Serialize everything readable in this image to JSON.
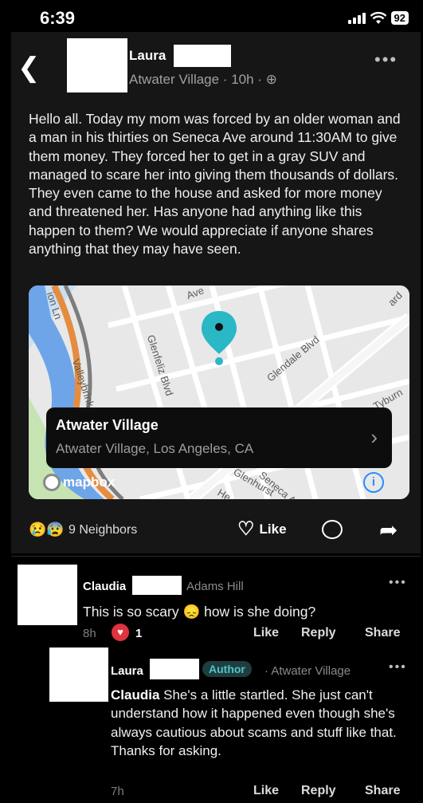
{
  "status": {
    "time": "6:39",
    "battery": "92"
  },
  "post": {
    "author_name": "Laura",
    "meta": "Atwater Village · 10h · ",
    "body": "Hello all. Today my mom was forced by an older woman and a man in his thirties on Seneca Ave around 11:30AM to give them money. They forced her to get in a gray SUV and managed to scare her into giving them thousands of dollars. They even came to the house and asked for more money and threatened her. Has anyone had anything like this happen to them? We would appreciate if anyone shares anything that they may have seen.",
    "location": {
      "title": "Atwater Village",
      "subtitle": "Atwater Village, Los Angeles, CA"
    },
    "map_labels": [
      "Valleybrink Rd",
      "Glenfeliz Blvd",
      "Glendale Blvd",
      "Seneca Ave",
      "Glenhurst",
      "ion Ln",
      "Tyburn",
      "Ave",
      "ard",
      "He"
    ],
    "map_brand": "mapbox",
    "neighbors": "9 Neighbors",
    "like_label": "Like"
  },
  "comments": [
    {
      "name": "Claudia",
      "neighborhood": "Adams Hill",
      "text": "This is so scary 😞 how is she doing?",
      "time": "8h",
      "reaction_count": "1",
      "like": "Like",
      "reply": "Reply",
      "share": "Share"
    },
    {
      "name": "Laura",
      "badge": "Author",
      "neighborhood": "· Atwater Village",
      "mention": "Claudia",
      "text": " She's a little startled. She just can't understand how it happened even though she's always cautious about scams and stuff like that. Thanks for asking.",
      "time": "7h",
      "like": "Like",
      "reply": "Reply",
      "share": "Share"
    }
  ],
  "colors": {
    "accent": "#2ab7c6",
    "heart": "#e0323f",
    "author_badge": "#4fc4c6"
  }
}
